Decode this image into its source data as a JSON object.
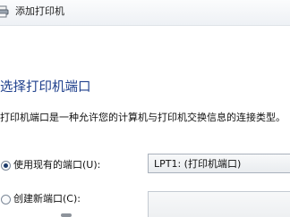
{
  "window": {
    "title": "添加打印机",
    "icon": "printer-icon"
  },
  "heading": "选择打印机端口",
  "description": "打印机端口是一种允许您的计算机与打印机交换信息的连接类型。",
  "options": {
    "existing_port": {
      "label": "使用现有的端口(U):",
      "selected": true
    },
    "new_port": {
      "label": "创建新端口(C):",
      "selected": false
    }
  },
  "existing_port_select": {
    "value": "LPT1: (打印机端口)"
  },
  "colors": {
    "heading": "#1e3f8c",
    "text": "#111111"
  }
}
